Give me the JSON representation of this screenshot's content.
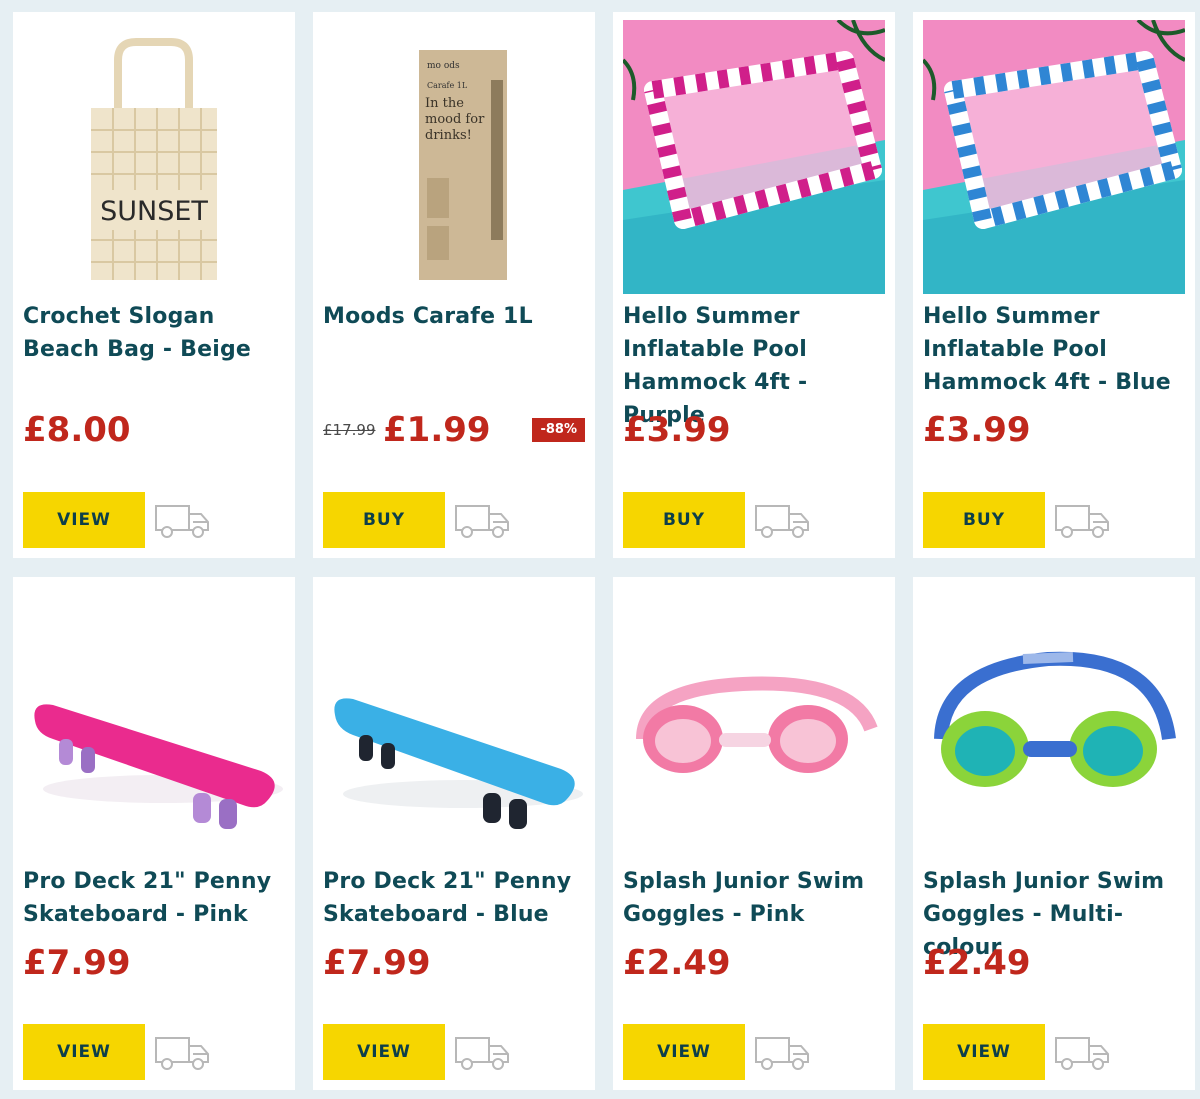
{
  "products": [
    {
      "title": "Crochet Slogan Beach Bag - Beige",
      "price": "£8.00",
      "button": "VIEW",
      "image_text": "SUNSET"
    },
    {
      "title": "Moods Carafe 1L",
      "old_price": "£17.99",
      "price": "£1.99",
      "discount": "-88%",
      "button": "BUY",
      "image_text": {
        "brand": "mo ods",
        "name": "Carafe 1L",
        "slogan": "In the mood for drinks!"
      }
    },
    {
      "title": "Hello Summer Inflatable Pool Hammock 4ft - Purple",
      "price": "£3.99",
      "button": "BUY",
      "accent": "#d01f8a"
    },
    {
      "title": "Hello Summer Inflatable Pool Hammock 4ft - Blue",
      "price": "£3.99",
      "button": "BUY",
      "accent": "#2f86d4"
    },
    {
      "title": "Pro Deck 21\" Penny Skateboard - Pink",
      "price": "£7.99",
      "button": "VIEW",
      "accent": "#ea2b8e"
    },
    {
      "title": "Pro Deck 21\" Penny Skateboard - Blue",
      "price": "£7.99",
      "button": "VIEW",
      "accent": "#3ab0e6"
    },
    {
      "title": "Splash Junior Swim Goggles - Pink",
      "price": "£2.49",
      "button": "VIEW",
      "accent": "#f27aa5"
    },
    {
      "title": "Splash Junior Swim Goggles - Multi-colour",
      "price": "£2.49",
      "button": "VIEW",
      "accent": "#3a6fd0"
    }
  ],
  "colors": {
    "price": "#c0271c",
    "title": "#0f4a56",
    "button_bg": "#f6d600",
    "button_text": "#0d3f4a",
    "background": "#e6eff3"
  },
  "icons": {
    "delivery": "delivery-van-icon"
  }
}
